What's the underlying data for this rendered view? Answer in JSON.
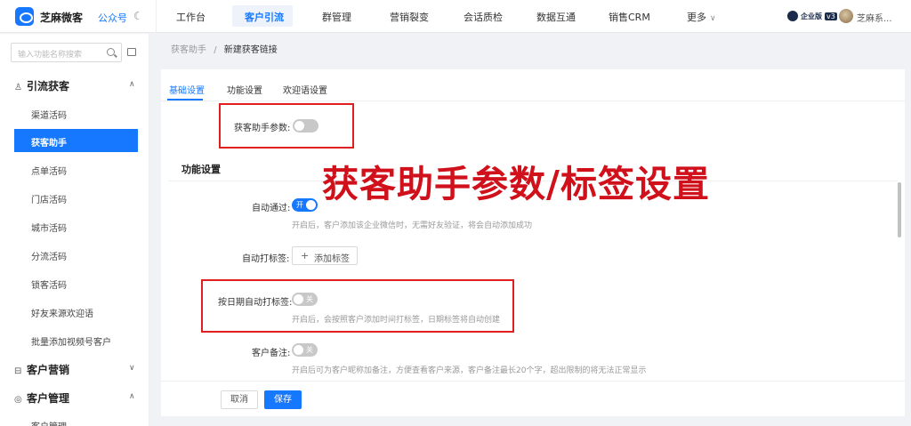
{
  "header": {
    "brand": "芝麻微客",
    "gzh": "公众号",
    "nav": [
      "工作台",
      "客户引流",
      "群管理",
      "营销裂变",
      "会话质检",
      "数据互通",
      "销售CRM",
      "更多"
    ],
    "active_nav": "客户引流",
    "badge": "企业版",
    "version": "v3",
    "user": "芝麻系..."
  },
  "sidebar": {
    "search_placeholder": "输入功能名称搜索",
    "group1": "引流获客",
    "items": [
      "渠道活码",
      "获客助手",
      "点单活码",
      "门店活码",
      "城市活码",
      "分流活码",
      "锁客活码",
      "好友来源欢迎语",
      "批量添加视频号客户"
    ],
    "active_item": "获客助手",
    "group2": "客户营销",
    "group3": "客户管理",
    "group3_item": "客户管理"
  },
  "breadcrumb": {
    "parent": "获客助手",
    "sep": "/",
    "current": "新建获客链接"
  },
  "tabs": [
    "基础设置",
    "功能设置",
    "欢迎语设置"
  ],
  "form": {
    "param_label": "获客助手参数:",
    "section_title": "功能设置",
    "auto_pass_label": "自动通过:",
    "auto_pass_state": "开",
    "auto_pass_hint": "开启后，客户添加该企业微信时，无需好友验证，将会自动添加成功",
    "auto_tag_label": "自动打标签:",
    "add_tag_button": "添加标签",
    "date_tag_label": "按日期自动打标签:",
    "date_tag_state": "关",
    "date_tag_hint": "开启后，会按照客户添加时间打标签，日期标签将自动创建",
    "remark_label": "客户备注:",
    "remark_state": "关",
    "remark_hint": "开启后可为客户昵称加备注，方便查看客户来源，客户备注最长20个字，超出限制的将无法正常显示"
  },
  "overlay_title": "获客助手参数/标签设置",
  "footer": {
    "cancel": "取消",
    "save": "保存"
  },
  "colors": {
    "accent": "#1677ff",
    "annotation": "#e02020"
  }
}
